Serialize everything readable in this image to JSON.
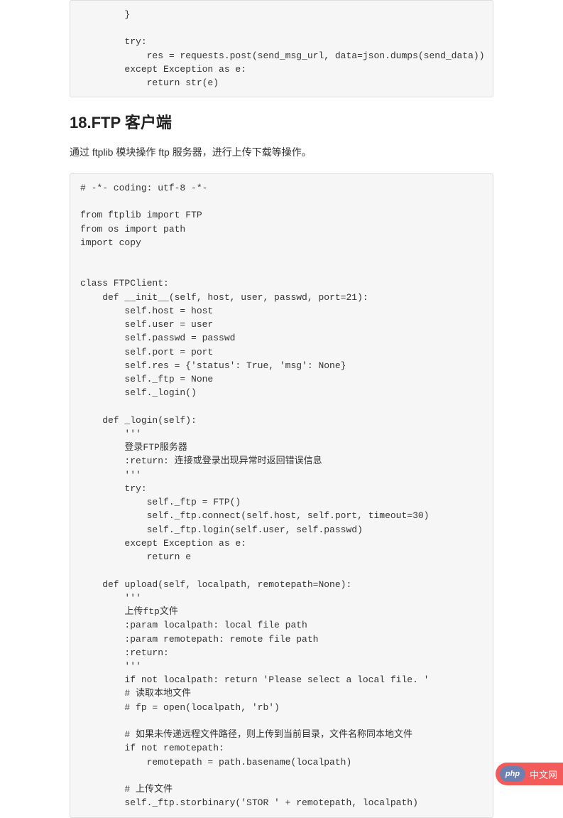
{
  "code_block_1": "        }\n\n        try:\n            res = requests.post(send_msg_url, data=json.dumps(send_data))\n        except Exception as e:\n            return str(e)",
  "heading": "18.FTP 客户端",
  "description": "通过 ftplib 模块操作 ftp 服务器，进行上传下载等操作。",
  "code_block_2": "# -*- coding: utf-8 -*-\n\nfrom ftplib import FTP\nfrom os import path\nimport copy\n\n\nclass FTPClient:\n    def __init__(self, host, user, passwd, port=21):\n        self.host = host\n        self.user = user\n        self.passwd = passwd\n        self.port = port\n        self.res = {'status': True, 'msg': None}\n        self._ftp = None\n        self._login()\n\n    def _login(self):\n        '''\n        登录FTP服务器\n        :return: 连接或登录出现异常时返回错误信息\n        '''\n        try:\n            self._ftp = FTP()\n            self._ftp.connect(self.host, self.port, timeout=30)\n            self._ftp.login(self.user, self.passwd)\n        except Exception as e:\n            return e\n\n    def upload(self, localpath, remotepath=None):\n        '''\n        上传ftp文件\n        :param localpath: local file path\n        :param remotepath: remote file path\n        :return:\n        '''\n        if not localpath: return 'Please select a local file. '\n        # 读取本地文件\n        # fp = open(localpath, 'rb')\n\n        # 如果未传递远程文件路径，则上传到当前目录，文件名称同本地文件\n        if not remotepath:\n            remotepath = path.basename(localpath)\n\n        # 上传文件\n        self._ftp.storbinary('STOR ' + remotepath, localpath)",
  "badge": {
    "logo_text": "php",
    "label": "中文网"
  }
}
